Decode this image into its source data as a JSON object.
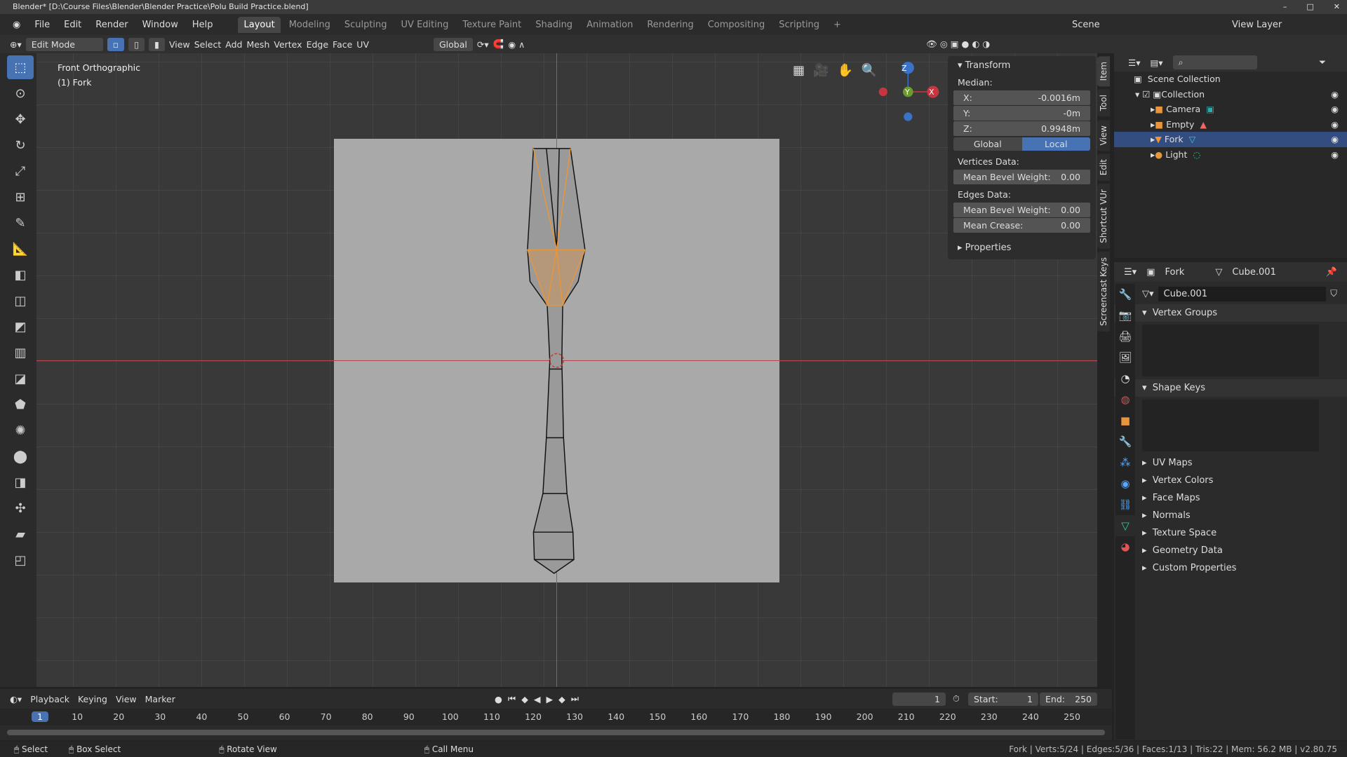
{
  "title": "Blender* [D:\\Course Files\\Blender\\Blender Practice\\Polu Build Practice.blend]",
  "menu": [
    "File",
    "Edit",
    "Render",
    "Window",
    "Help"
  ],
  "workspaces": [
    "Layout",
    "Modeling",
    "Sculpting",
    "UV Editing",
    "Texture Paint",
    "Shading",
    "Animation",
    "Rendering",
    "Compositing",
    "Scripting"
  ],
  "active_workspace": "Layout",
  "scene": "Scene",
  "view_layer": "View Layer",
  "header": {
    "mode": "Edit Mode",
    "menus": [
      "View",
      "Select",
      "Add",
      "Mesh",
      "Vertex",
      "Edge",
      "Face",
      "UV"
    ],
    "orientation": "Global"
  },
  "viewport": {
    "view_name": "Front Orthographic",
    "object": "(1) Fork",
    "gizmo": {
      "z": "Z",
      "y": "Y",
      "x": "X"
    }
  },
  "npanel": {
    "section": "Transform",
    "median": "Median:",
    "x_label": "X:",
    "x": "-0.0016m",
    "y_label": "Y:",
    "y": "-0m",
    "z_label": "Z:",
    "z": "0.9948m",
    "global": "Global",
    "local": "Local",
    "active_space": "Local",
    "vertices_data": "Vertices Data:",
    "v_bevel_label": "Mean Bevel Weight:",
    "v_bevel": "0.00",
    "edges_data": "Edges Data:",
    "e_bevel_label": "Mean Bevel Weight:",
    "e_bevel": "0.00",
    "crease_label": "Mean Crease:",
    "crease": "0.00",
    "properties": "Properties",
    "tabs": [
      "Item",
      "Tool",
      "View",
      "Edit",
      "Shortcut VUr",
      "Screencast Keys"
    ]
  },
  "outliner": {
    "root": "Scene Collection",
    "collection": "Collection",
    "items": [
      {
        "name": "Camera",
        "color": "#e8963c"
      },
      {
        "name": "Empty",
        "color": "#e8963c"
      },
      {
        "name": "Fork",
        "color": "#e8963c",
        "selected": true
      },
      {
        "name": "Light",
        "color": "#e8963c"
      }
    ]
  },
  "properties": {
    "object": "Fork",
    "mesh": "Cube.001",
    "datablock": "Cube.001",
    "vertex_groups": "Vertex Groups",
    "shape_keys": "Shape Keys",
    "sections": [
      "UV Maps",
      "Vertex Colors",
      "Face Maps",
      "Normals",
      "Texture Space",
      "Geometry Data",
      "Custom Properties"
    ]
  },
  "timeline": {
    "menus": [
      "Playback",
      "Keying",
      "View",
      "Marker"
    ],
    "current_frame": "1",
    "start_label": "Start:",
    "start": "1",
    "end_label": "End:",
    "end": "250",
    "ticks": [
      "1",
      "10",
      "20",
      "30",
      "40",
      "50",
      "60",
      "70",
      "80",
      "90",
      "100",
      "110",
      "120",
      "130",
      "140",
      "150",
      "160",
      "170",
      "180",
      "190",
      "200",
      "210",
      "220",
      "230",
      "240",
      "250"
    ]
  },
  "status": {
    "select": "Select",
    "box_select": "Box Select",
    "rotate": "Rotate View",
    "call_menu": "Call Menu",
    "stats": "Fork | Verts:5/24 | Edges:5/36 | Faces:1/13 | Tris:22 | Mem: 56.2 MB | v2.80.75"
  },
  "colors": {
    "accent": "#4772b3",
    "selection": "#e8963c",
    "x_axis": "#c8353f",
    "z_axis": "#3a72c8"
  }
}
